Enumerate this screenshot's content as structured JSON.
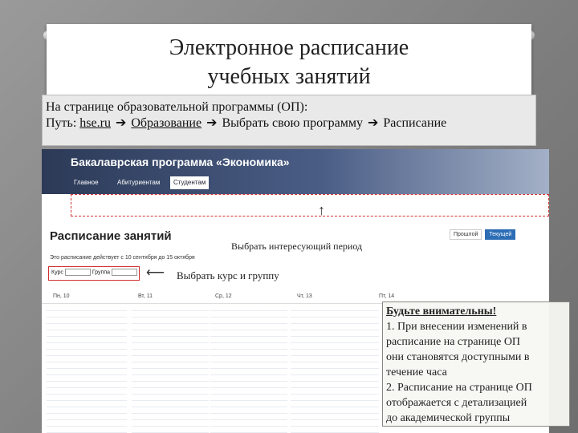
{
  "slide": {
    "title_line1": "Электронное расписание",
    "title_line2": "учебных занятий"
  },
  "path": {
    "line1": "На странице образовательной программы (ОП):",
    "prefix": "Путь:",
    "step1": "hse.ru",
    "step2": "Образование",
    "step3": "Выбрать свою программу",
    "step4": "Расписание"
  },
  "site": {
    "banner_title": "Бакалаврская программа «Экономика»",
    "nav": [
      "Главное",
      "Абитуриентам",
      "Студентам"
    ],
    "nav_active": "Студентам",
    "heading": "Расписание занятий",
    "subline": "Это расписание действует с 10 сентября до 15 октября",
    "course_label": "Курс",
    "group_label": "Группа",
    "buttons": [
      "Прошлой",
      "Текущей"
    ],
    "col_headers": [
      "Пн, 10",
      "Вт, 11",
      "Ср, 12",
      "Чт, 13",
      "Пт, 14"
    ]
  },
  "annotations": {
    "period": "Выбрать интересующий период",
    "course": "Выбрать курс и группу"
  },
  "warning": {
    "title": "Будьте внимательны!",
    "l1": "1. При внесении изменений в",
    "l2": "расписание на странице ОП",
    "l3": "они становятся доступными в",
    "l4": "течение часа",
    "l5": "2. Расписание на странице ОП",
    "l6": "отображается с детализацией",
    "l7": "до академической группы"
  }
}
